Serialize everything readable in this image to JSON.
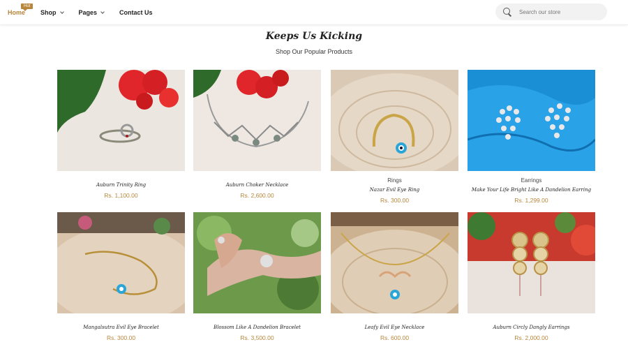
{
  "nav": {
    "items": [
      {
        "label": "Home",
        "badge": "Hot"
      },
      {
        "label": "Shop"
      },
      {
        "label": "Pages"
      },
      {
        "label": "Contact Us"
      }
    ]
  },
  "search": {
    "placeholder": "Search our store",
    "icon": "search-icon"
  },
  "section": {
    "title": "Keeps Us Kicking",
    "subtitle": "Shop Our Popular Products"
  },
  "products": [
    {
      "category": "",
      "name": "Auburn Trinity Ring",
      "price": "Rs. 1,100.00"
    },
    {
      "category": "",
      "name": "Auburn Choker Necklace",
      "price": "Rs. 2,600.00"
    },
    {
      "category": "Rings",
      "name": "Nazar Evil Eye Ring",
      "price": "Rs. 300.00"
    },
    {
      "category": "Earrings",
      "name": "Make Your Life Bright Like A Dandelion Earring",
      "price": "Rs. 1,299.00"
    },
    {
      "category": "",
      "name": "Mangalsutra Evil Eye Bracelet",
      "price": "Rs. 300.00"
    },
    {
      "category": "",
      "name": "Blossom Like A Dandelion Bracelet",
      "price": "Rs. 3,500.00"
    },
    {
      "category": "",
      "name": "Leafy Evil Eye Necklace",
      "price": "Rs. 600.00"
    },
    {
      "category": "",
      "name": "Auburn Circly Dangly Earrings",
      "price": "Rs. 2,000.00"
    }
  ],
  "colors": {
    "accent": "#b8863b",
    "text": "#222222"
  }
}
